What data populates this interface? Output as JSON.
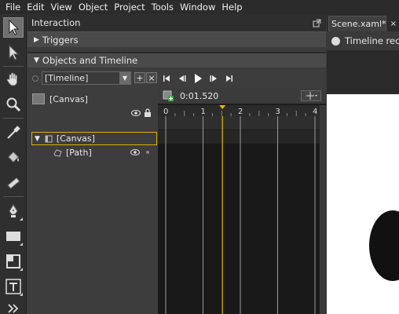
{
  "menubar": {
    "items": [
      {
        "label": "File"
      },
      {
        "label": "Edit"
      },
      {
        "label": "View"
      },
      {
        "label": "Object"
      },
      {
        "label": "Project"
      },
      {
        "label": "Tools"
      },
      {
        "label": "Window"
      },
      {
        "label": "Help"
      }
    ]
  },
  "toolbox": {
    "tools": [
      "selection-arrow-icon",
      "direct-selection-icon",
      "pan-hand-icon",
      "zoom-icon",
      "eyedropper-icon",
      "paint-bucket-icon",
      "brush-icon",
      "pen-icon",
      "rectangle-icon",
      "layout-grid-icon",
      "text-icon",
      "more-tools-icon"
    ]
  },
  "interaction": {
    "title": "Interaction",
    "triggers_label": "Triggers",
    "objects_label": "Objects and Timeline",
    "timeline_selected": "[Timeline]",
    "time_display": "0:01.520",
    "root_label": "[Canvas]",
    "tree": [
      {
        "label": "[Canvas]"
      },
      {
        "label": "[Path]"
      }
    ],
    "ruler_ticks": [
      "0",
      "1",
      "2",
      "3",
      "4"
    ],
    "playhead_seconds": 1.52
  },
  "document": {
    "tab_label": "Scene.xaml*",
    "recording_label": "Timeline recording is on"
  },
  "colors": {
    "accent": "#e8b800",
    "background": "#3c3c3c",
    "stage": "#ffffff"
  }
}
